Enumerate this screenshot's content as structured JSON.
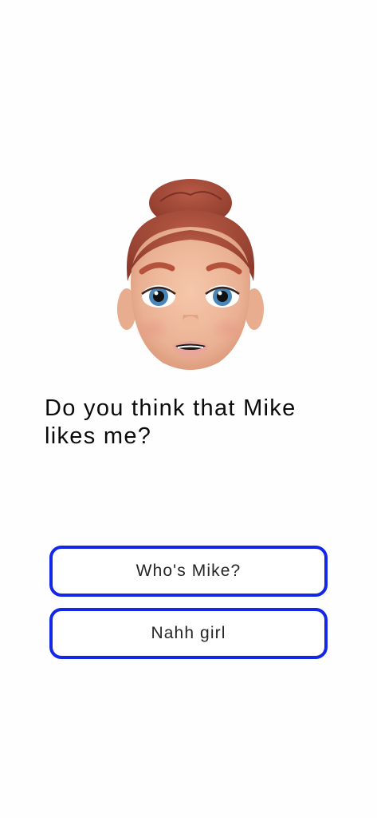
{
  "prompt": {
    "avatar_description": "memoji-avatar",
    "question": "Do you think that Mike likes me?"
  },
  "answers": [
    {
      "label": "Who's Mike?"
    },
    {
      "label": "Nahh girl"
    }
  ],
  "colors": {
    "button_border": "#1228e6",
    "text": "#0a0a0a",
    "background": "#ffffff"
  }
}
